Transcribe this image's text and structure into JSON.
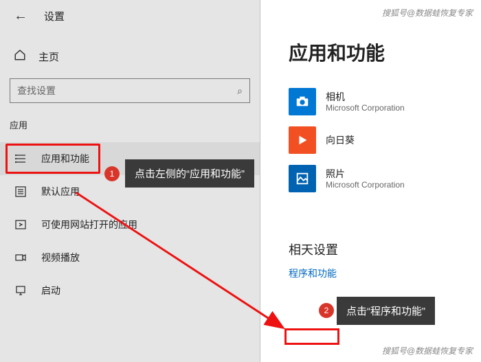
{
  "header": {
    "settings_title": "设置"
  },
  "sidebar": {
    "home_label": "主页",
    "search_placeholder": "查找设置",
    "section_label": "应用",
    "items": [
      {
        "label": "应用和功能"
      },
      {
        "label": "默认应用"
      },
      {
        "label": "可使用网站打开的应用"
      },
      {
        "label": "视频播放"
      },
      {
        "label": "启动"
      }
    ]
  },
  "annotations": {
    "badge1": "1",
    "tooltip1": "点击左侧的“应用和功能”",
    "badge2": "2",
    "tooltip2": "点击“程序和功能”"
  },
  "content": {
    "heading": "应用和功能",
    "apps": [
      {
        "name": "相机",
        "publisher": "Microsoft Corporation"
      },
      {
        "name": "向日葵",
        "publisher": ""
      },
      {
        "name": "照片",
        "publisher": "Microsoft Corporation"
      }
    ],
    "related_heading": "相天设置",
    "related_link": "程序和功能"
  },
  "watermark": "搜狐号@数据蛙恢复专家"
}
